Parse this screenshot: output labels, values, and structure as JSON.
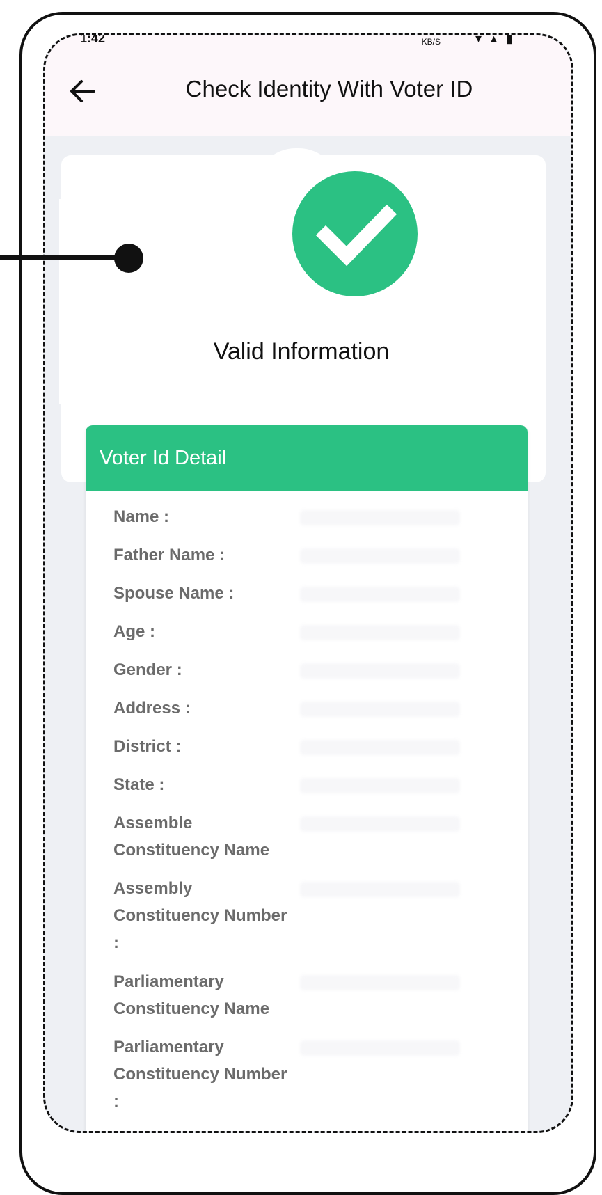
{
  "status_bar": {
    "time": "1:42",
    "net_speed": "KB/S"
  },
  "app_bar": {
    "title": "Check Identity With Voter ID"
  },
  "status": {
    "title": "Valid Information"
  },
  "detail": {
    "header": "Voter Id Detail",
    "fields": [
      {
        "label": "Name :"
      },
      {
        "label": "Father Name :"
      },
      {
        "label": "Spouse Name :"
      },
      {
        "label": "Age :"
      },
      {
        "label": "Gender :"
      },
      {
        "label": "Address :"
      },
      {
        "label": "District :"
      },
      {
        "label": "State :"
      },
      {
        "label": "Assemble Constituency Name"
      },
      {
        "label": "Assembly Constituency Number :"
      },
      {
        "label": "Parliamentary Constituency Name"
      },
      {
        "label": "Parliamentary Constituency Number :"
      }
    ]
  },
  "colors": {
    "accent": "#2bc183",
    "app_bar_bg": "#fdf7fa",
    "screen_bg": "#eef0f4"
  },
  "icons": {
    "back": "arrow-left-icon",
    "status": "check-circle-icon"
  }
}
